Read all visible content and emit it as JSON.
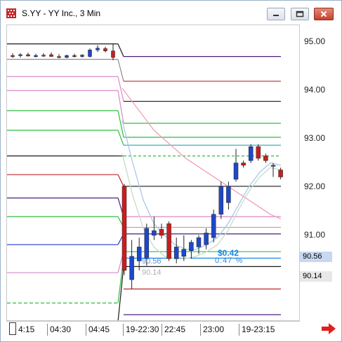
{
  "window": {
    "title": "S.YY - YY Inc., 3 Min",
    "app_icon": "chart-app-icon",
    "controls": [
      "minimize-icon",
      "maximize-icon",
      "close-icon"
    ]
  },
  "price_axis": {
    "ticks": [
      "95.00",
      "94.00",
      "93.00",
      "92.00",
      "91.00"
    ],
    "last_price_tag": {
      "value": "90.56",
      "color": "#c8d8f0"
    },
    "second_price_tag": {
      "value": "90.14",
      "color": "#e8e8e8"
    }
  },
  "time_axis": {
    "ticks": [
      "4:15",
      "04:30",
      "04:45",
      "19-22:30",
      "22:45",
      "23:00",
      "19-23:15"
    ]
  },
  "overlay": {
    "change_amount": "$0.42",
    "change_percent": "0.47 %",
    "level_label_1": "90.56",
    "level_label_2": "90.14",
    "accent_color": "#1e88e5"
  },
  "chart_data": {
    "type": "candlestick",
    "symbol": "S.YY",
    "interval": "3 Min",
    "ylim": [
      89.2,
      95.55
    ],
    "pre_gap_candles": [
      {
        "o": 94.9,
        "h": 94.95,
        "l": 94.85,
        "c": 94.88
      },
      {
        "o": 94.9,
        "h": 94.95,
        "l": 94.86,
        "c": 94.92
      },
      {
        "o": 94.92,
        "h": 94.96,
        "l": 94.88,
        "c": 94.89
      },
      {
        "o": 94.9,
        "h": 94.94,
        "l": 94.86,
        "c": 94.9
      },
      {
        "o": 94.91,
        "h": 94.95,
        "l": 94.87,
        "c": 94.9
      },
      {
        "o": 94.92,
        "h": 94.97,
        "l": 94.88,
        "c": 94.88
      },
      {
        "o": 94.88,
        "h": 94.93,
        "l": 94.84,
        "c": 94.86
      },
      {
        "o": 94.86,
        "h": 94.92,
        "l": 94.84,
        "c": 94.9
      },
      {
        "o": 94.9,
        "h": 94.94,
        "l": 94.86,
        "c": 94.88
      },
      {
        "o": 94.88,
        "h": 94.93,
        "l": 94.86,
        "c": 94.91
      },
      {
        "o": 94.88,
        "h": 95.05,
        "l": 94.86,
        "c": 95.02
      },
      {
        "o": 95.02,
        "h": 95.12,
        "l": 94.98,
        "c": 95.06
      },
      {
        "o": 95.05,
        "h": 95.09,
        "l": 94.97,
        "c": 95.0
      },
      {
        "o": 95.0,
        "h": 95.15,
        "l": 94.8,
        "c": 94.86
      }
    ],
    "post_gap_candles": [
      {
        "o": 92.1,
        "h": 92.15,
        "l": 90.2,
        "c": 90.3
      },
      {
        "o": 90.1,
        "h": 90.95,
        "l": 89.9,
        "c": 90.6
      },
      {
        "o": 90.5,
        "h": 91.0,
        "l": 90.3,
        "c": 90.8
      },
      {
        "o": 90.55,
        "h": 91.3,
        "l": 90.4,
        "c": 91.2
      },
      {
        "o": 91.05,
        "h": 91.45,
        "l": 90.95,
        "c": 91.15
      },
      {
        "o": 91.18,
        "h": 91.3,
        "l": 90.98,
        "c": 91.05
      },
      {
        "o": 91.3,
        "h": 91.35,
        "l": 90.5,
        "c": 90.55
      },
      {
        "o": 90.55,
        "h": 91.0,
        "l": 90.45,
        "c": 90.8
      },
      {
        "o": 90.6,
        "h": 91.05,
        "l": 90.5,
        "c": 90.75
      },
      {
        "o": 90.72,
        "h": 90.95,
        "l": 90.55,
        "c": 90.9
      },
      {
        "o": 90.8,
        "h": 91.05,
        "l": 90.65,
        "c": 91.0
      },
      {
        "o": 90.85,
        "h": 91.2,
        "l": 90.75,
        "c": 91.1
      },
      {
        "o": 91.0,
        "h": 91.6,
        "l": 90.9,
        "c": 91.5
      },
      {
        "o": 91.5,
        "h": 92.2,
        "l": 91.4,
        "c": 92.1
      },
      {
        "o": 91.75,
        "h": 92.2,
        "l": 91.6,
        "c": 92.1
      },
      {
        "o": 92.25,
        "h": 92.9,
        "l": 92.2,
        "c": 92.6
      },
      {
        "o": 92.6,
        "h": 92.65,
        "l": 92.5,
        "c": 92.55
      },
      {
        "o": 92.65,
        "h": 93.0,
        "l": 92.6,
        "c": 92.95
      },
      {
        "o": 92.95,
        "h": 93.0,
        "l": 92.65,
        "c": 92.7
      },
      {
        "o": 92.75,
        "h": 92.8,
        "l": 92.6,
        "c": 92.65
      },
      {
        "o": 92.55,
        "h": 92.6,
        "l": 92.3,
        "c": 92.55
      },
      {
        "o": 92.45,
        "h": 92.5,
        "l": 92.25,
        "c": 92.3
      }
    ],
    "level_lines_pre": [
      {
        "price": 95.15,
        "color": "#1a1a1a"
      },
      {
        "price": 94.82,
        "color": "#8c8c8c"
      },
      {
        "price": 94.45,
        "color": "#d889c8"
      },
      {
        "price": 94.15,
        "color": "#d889c8"
      },
      {
        "price": 93.72,
        "color": "#2ebd3f"
      },
      {
        "price": 93.3,
        "color": "#2ebd3f"
      },
      {
        "price": 92.75,
        "color": "#1a1a1a"
      },
      {
        "price": 92.35,
        "color": "#c0282b"
      },
      {
        "price": 91.85,
        "color": "#4b1f7a"
      },
      {
        "price": 91.45,
        "color": "#2ebd3f"
      },
      {
        "price": 90.85,
        "color": "#1e38d6"
      },
      {
        "price": 90.25,
        "color": "#d889c8"
      },
      {
        "price": 89.6,
        "color": "#2ebd3f",
        "dashed": true
      },
      {
        "price": 89.2,
        "color": "#1a1a1a",
        "dashed": true
      }
    ],
    "level_lines_post": [
      {
        "price": 94.88,
        "color": "#4b1f7a"
      },
      {
        "price": 94.35,
        "color": "#c0282b"
      },
      {
        "price": 93.92,
        "color": "#1a1a1a"
      },
      {
        "price": 93.45,
        "color": "#2ebd3f"
      },
      {
        "price": 93.15,
        "color": "#2ebd3f"
      },
      {
        "price": 92.98,
        "color": "#1eaab8"
      },
      {
        "price": 92.75,
        "color": "#2ebd3f",
        "dashed": true
      },
      {
        "price": 92.1,
        "color": "#1a1a1a"
      },
      {
        "price": 91.45,
        "color": "#d889c8"
      },
      {
        "price": 91.22,
        "color": "#d889c8"
      },
      {
        "price": 91.08,
        "color": "#4b1f7a"
      },
      {
        "price": 90.7,
        "color": "#2ebd3f"
      },
      {
        "price": 90.56,
        "color": "#1e88e5"
      },
      {
        "price": 90.38,
        "color": "#1a1a1a"
      },
      {
        "price": 89.9,
        "color": "#c0282b"
      },
      {
        "price": 89.35,
        "color": "#4b1f7a"
      }
    ],
    "moving_averages": [
      {
        "name": "ma-pink",
        "color": "#f0a0b8",
        "values": [
          94.2,
          93.9,
          93.6,
          93.3,
          93.1,
          92.9,
          92.7,
          92.55,
          92.4,
          92.25,
          92.1,
          91.95,
          91.8,
          91.65,
          91.5,
          91.4
        ]
      },
      {
        "name": "ma-blue",
        "color": "#a8c8e8",
        "values": [
          93.5,
          92.6,
          91.8,
          91.3,
          91.05,
          90.85,
          90.75,
          90.75,
          90.85,
          91.0,
          91.3,
          91.7,
          92.1,
          92.4,
          92.6,
          92.55
        ]
      },
      {
        "name": "ma-sage",
        "color": "#c8dcc8",
        "values": [
          92.8,
          91.9,
          91.2,
          90.8,
          90.6,
          90.55,
          90.55,
          90.6,
          90.7,
          90.85,
          91.15,
          91.6,
          92.0,
          92.3,
          92.5,
          92.45
        ]
      }
    ]
  }
}
